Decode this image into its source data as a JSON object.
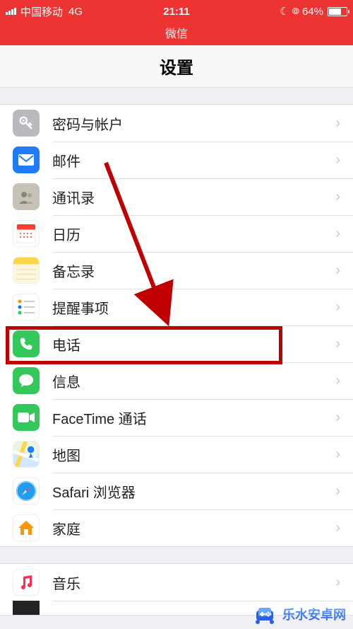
{
  "status": {
    "carrier": "中国移动",
    "network": "4G",
    "time": "21:11",
    "battery_pct": "64%"
  },
  "nav": {
    "title": "微信"
  },
  "page": {
    "title": "设置"
  },
  "rows": {
    "passwords": "密码与帐户",
    "mail": "邮件",
    "contacts": "通讯录",
    "calendar": "日历",
    "notes": "备忘录",
    "reminders": "提醒事项",
    "phone": "电话",
    "messages": "信息",
    "facetime": "FaceTime 通话",
    "maps": "地图",
    "safari": "Safari 浏览器",
    "home": "家庭",
    "music": "音乐"
  },
  "watermark": {
    "text": "乐水安卓网"
  }
}
